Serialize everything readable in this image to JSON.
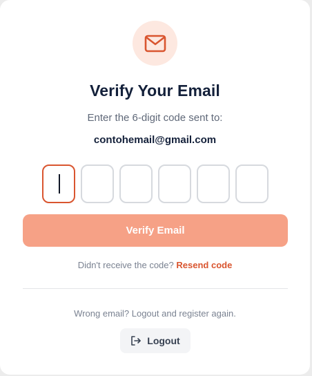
{
  "header": {
    "title": "Verify Your Email",
    "subtitle": "Enter the 6-digit code sent to:",
    "email": "contohemail@gmail.com",
    "icon": "mail-icon"
  },
  "code": {
    "length": 6,
    "values": [
      "",
      "",
      "",
      "",
      "",
      ""
    ],
    "active_index": 0
  },
  "actions": {
    "verify_label": "Verify Email",
    "resend_prompt": "Didn't receive the code?",
    "resend_link": "Resend code",
    "wrong_email_text": "Wrong email? Logout and register again.",
    "logout_label": "Logout",
    "logout_icon": "logout-icon"
  },
  "colors": {
    "accent": "#d9552f",
    "button_bg": "#f6a186",
    "icon_circle_bg": "#fde8e0",
    "title": "#13203a"
  }
}
